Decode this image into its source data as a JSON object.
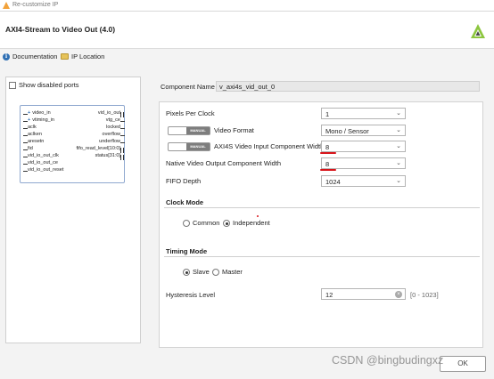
{
  "window": {
    "title": "Re-customize IP"
  },
  "header": {
    "ip_name": "AXI4-Stream to Video Out (4.0)"
  },
  "links": {
    "documentation": "Documentation",
    "ip_location": "IP Location"
  },
  "left_panel": {
    "show_disabled_ports": "Show disabled ports",
    "ports_left": [
      "video_in",
      "vtiming_in",
      "aclk",
      "aclken",
      "aresetn",
      "fid",
      "vid_io_out_clk",
      "vid_io_out_ce",
      "vid_io_out_reset"
    ],
    "ports_right": [
      "vid_io_out",
      "vtg_ce",
      "locked",
      "overflow",
      "underflow",
      "fifo_read_level[10:0]",
      "status[31:0]"
    ]
  },
  "component_name": {
    "label": "Component Name",
    "value": "v_axi4s_vid_out_0"
  },
  "params": {
    "pixels_per_clock": {
      "label": "Pixels Per Clock",
      "value": "1"
    },
    "video_format": {
      "label": "Video Format",
      "value": "Mono / Sensor",
      "mode": "MANUAL"
    },
    "axi4s_width": {
      "label": "AXI4S Video Input Component Width",
      "value": "8",
      "mode": "MANUAL"
    },
    "native_width": {
      "label": "Native Video Output Component Width",
      "value": "8"
    },
    "fifo_depth": {
      "label": "FIFO Depth",
      "value": "1024"
    }
  },
  "clock_mode": {
    "title": "Clock Mode",
    "common": "Common",
    "independent": "Independent",
    "selected": "Independent"
  },
  "timing_mode": {
    "title": "Timing Mode",
    "slave": "Slave",
    "master": "Master",
    "selected": "Slave"
  },
  "hysteresis": {
    "label": "Hysteresis Level",
    "value": "12",
    "range": "[0 - 1023]"
  },
  "watermark": "CSDN @bingbudingxz",
  "ok_button": "OK",
  "colors": {
    "annotation_red": "#d8141a",
    "info_blue": "#2f6fb3"
  }
}
